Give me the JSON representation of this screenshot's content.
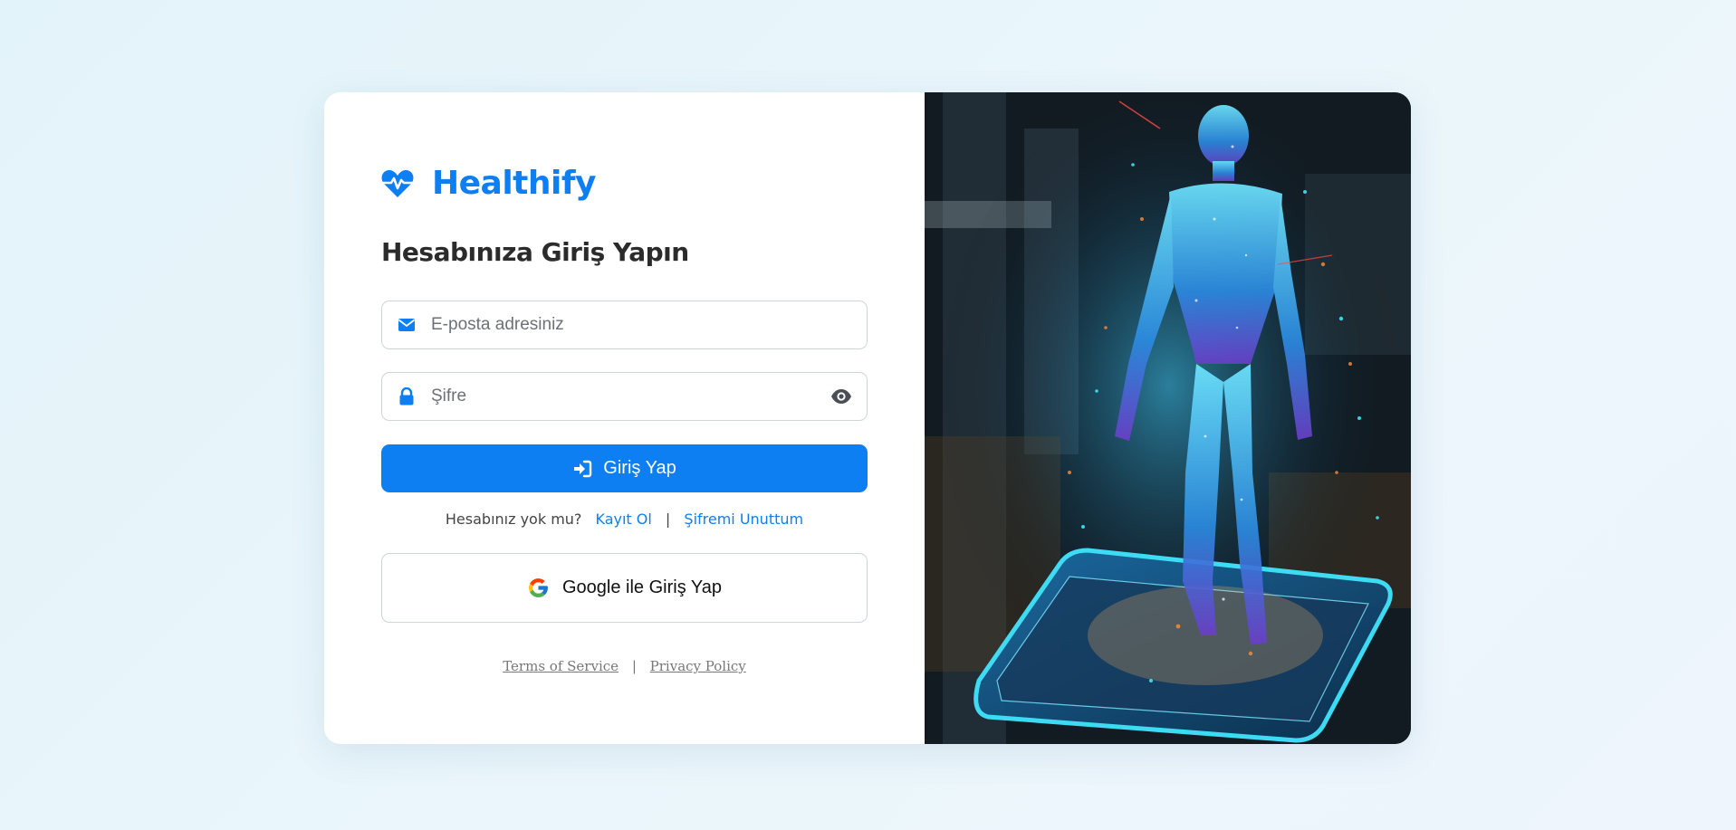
{
  "brand": {
    "name": "Healthify",
    "icon": "heart-pulse-icon",
    "color": "#0d7ff2"
  },
  "login": {
    "heading": "Hesabınıza Giriş Yapın",
    "email": {
      "placeholder": "E-posta adresiniz",
      "icon": "envelope-icon"
    },
    "password": {
      "placeholder": "Şifre",
      "icon": "lock-icon",
      "toggle_icon": "eye-icon"
    },
    "submit_label": "Giriş Yap",
    "submit_icon": "sign-in-icon",
    "no_account_text": "Hesabınız yok mu?",
    "register_link": "Kayıt Ol",
    "separator": "|",
    "forgot_link": "Şifremi Unuttum",
    "google_label": "Google ile Giriş Yap",
    "google_icon": "google-icon"
  },
  "legal": {
    "terms": "Terms of Service",
    "separator": "|",
    "privacy": "Privacy Policy"
  },
  "colors": {
    "primary": "#0d7ff2",
    "background": "#e8f5fb",
    "card": "#ffffff"
  },
  "hero_image": "holographic-human-figure-on-phone"
}
